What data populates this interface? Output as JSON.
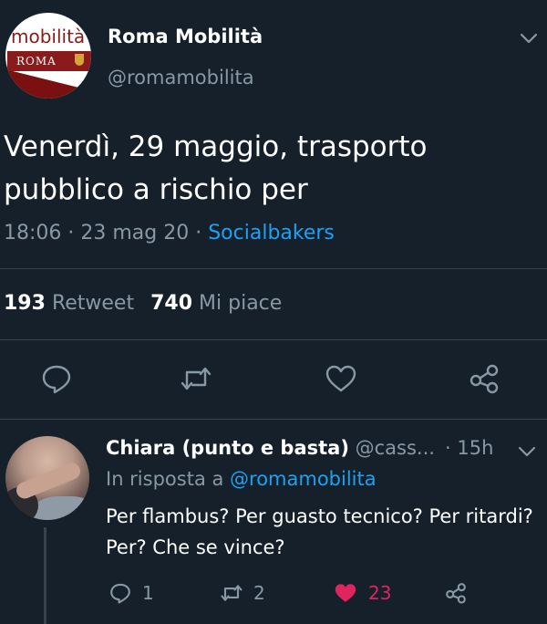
{
  "tweet": {
    "avatar_word": "mobilità",
    "avatar_roma": "ROMA",
    "name": "Roma Mobilità",
    "handle": "@romamobilita",
    "text": "Venerdì, 29 maggio, trasporto pubblico a rischio per",
    "time": "18:06 · 23 mag 20 · ",
    "source": "Socialbakers",
    "retweets": "193",
    "retweets_label": "Retweet",
    "likes": "740",
    "likes_label": "Mi piace"
  },
  "reply": {
    "name": "Chiara (punto e basta)",
    "handle": "@cass...",
    "time": "· 15h",
    "reply_prefix": "In risposta a ",
    "reply_mention": "@romamobilita",
    "text": "Per flambus? Per guasto tecnico? Per ritardi? Per? Che se vince?",
    "reply_count": "1",
    "retweet_count": "2",
    "like_count": "23"
  },
  "colors": {
    "background": "#15202b",
    "secondary_text": "#8899a6",
    "link": "#1da1f2",
    "like": "#e0245e",
    "divider": "#38444d"
  },
  "icons": [
    "chevron-down-icon",
    "reply-icon",
    "retweet-icon",
    "heart-icon",
    "share-icon"
  ]
}
